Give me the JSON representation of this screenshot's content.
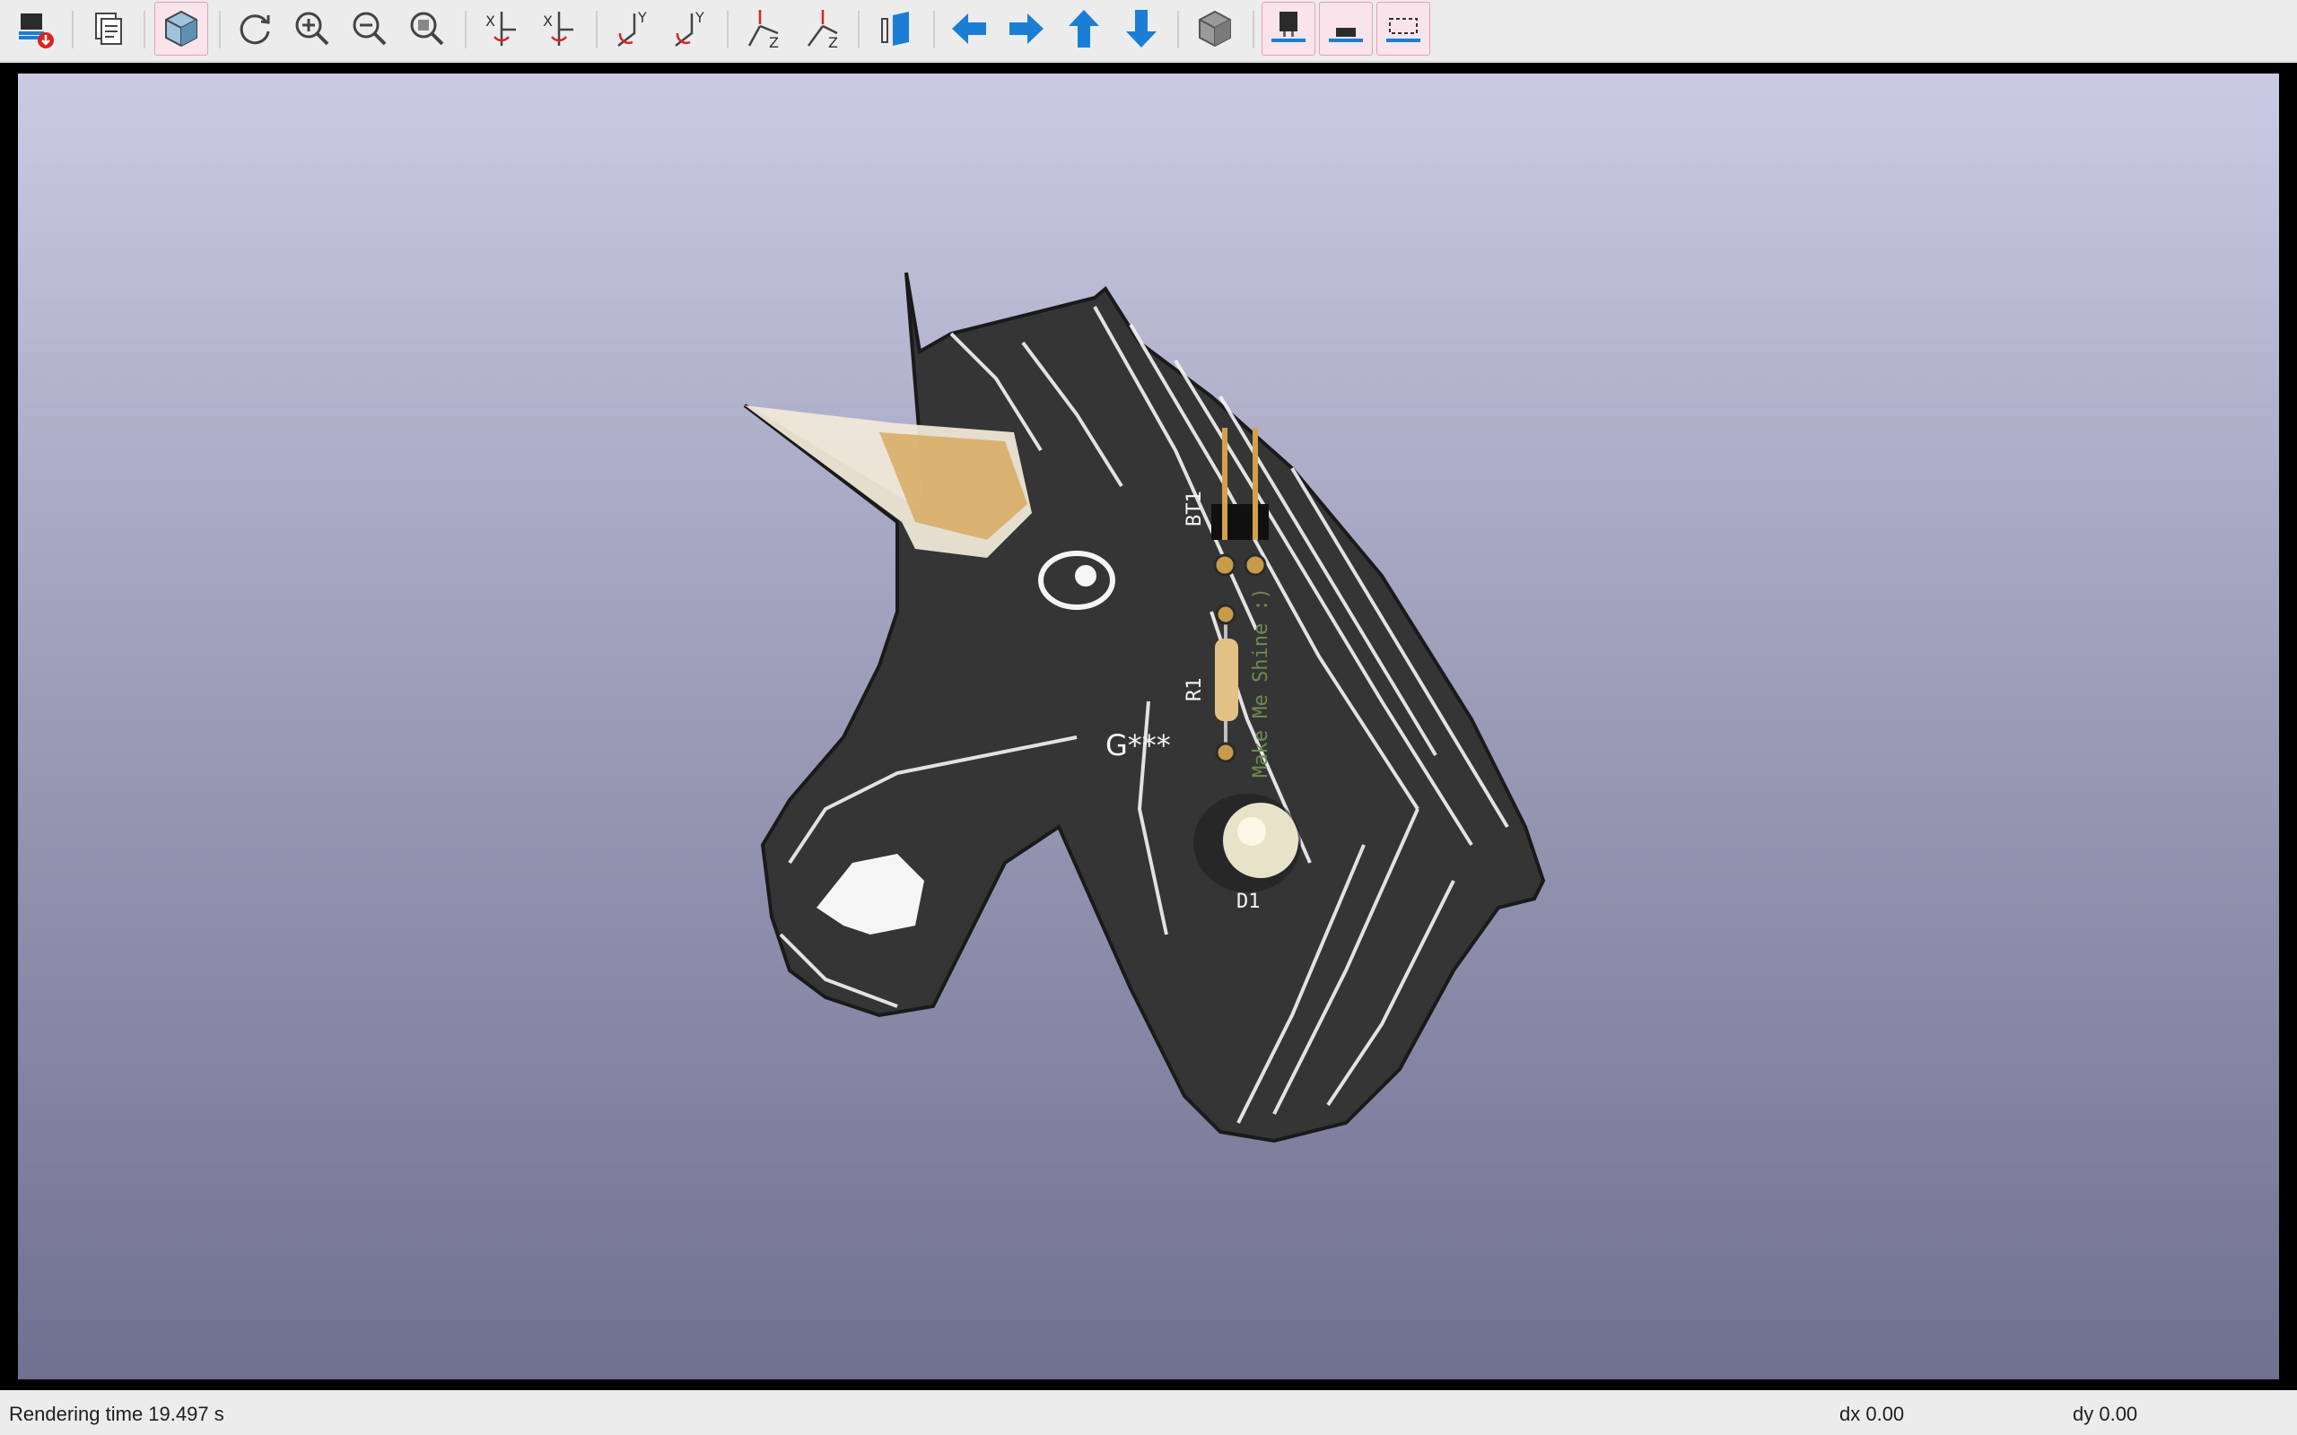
{
  "toolbar": {
    "buttons": [
      {
        "name": "export-image-button",
        "icon": "export-icon"
      },
      {
        "name": "copy-to-clipboard-button",
        "icon": "copy-icon"
      },
      {
        "name": "raytracing-toggle-button",
        "icon": "cube-shaded-icon",
        "active": true
      },
      {
        "name": "reload-button",
        "icon": "reload-icon"
      },
      {
        "name": "zoom-in-button",
        "icon": "zoom-in-icon"
      },
      {
        "name": "zoom-out-button",
        "icon": "zoom-out-icon"
      },
      {
        "name": "zoom-fit-button",
        "icon": "zoom-fit-icon"
      },
      {
        "name": "rotate-x-cw-button",
        "icon": "rotate-x-cw-icon"
      },
      {
        "name": "rotate-x-ccw-button",
        "icon": "rotate-x-ccw-icon"
      },
      {
        "name": "rotate-y-cw-button",
        "icon": "rotate-y-cw-icon"
      },
      {
        "name": "rotate-y-ccw-button",
        "icon": "rotate-y-ccw-icon"
      },
      {
        "name": "rotate-z-cw-button",
        "icon": "rotate-z-cw-icon"
      },
      {
        "name": "rotate-z-ccw-button",
        "icon": "rotate-z-ccw-icon"
      },
      {
        "name": "flip-board-button",
        "icon": "flip-board-icon"
      },
      {
        "name": "move-left-button",
        "icon": "arrow-left-icon"
      },
      {
        "name": "move-right-button",
        "icon": "arrow-right-icon"
      },
      {
        "name": "move-up-button",
        "icon": "arrow-up-icon"
      },
      {
        "name": "move-down-button",
        "icon": "arrow-down-icon"
      },
      {
        "name": "orthographic-toggle-button",
        "icon": "ortho-cube-icon"
      },
      {
        "name": "show-tht-button",
        "icon": "tht-component-icon",
        "active": true
      },
      {
        "name": "show-smd-button",
        "icon": "smd-component-icon",
        "active": true
      },
      {
        "name": "show-virtual-button",
        "icon": "virtual-component-icon",
        "active": true
      }
    ]
  },
  "board": {
    "silkscreen": {
      "bt1": "BT1",
      "r1": "R1",
      "d1": "D1",
      "ref_placeholder": "G***",
      "message": "Make Me Shine :)"
    }
  },
  "colors": {
    "accent_blue": "#1a7fd4",
    "pcb_black": "#353535",
    "silk_white": "#f5f5f5",
    "gold": "#d4a04a",
    "message_green": "#6f8b4e"
  },
  "status": {
    "render_time": "Rendering time 19.497 s",
    "dx": "dx 0.00",
    "dy": "dy 0.00"
  }
}
